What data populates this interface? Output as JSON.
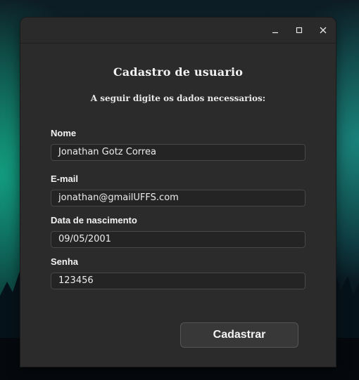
{
  "window": {
    "controls": {
      "minimize_icon": "minimize-icon",
      "maximize_icon": "maximize-icon",
      "close_icon": "close-icon"
    }
  },
  "form": {
    "title": "Cadastro de usuario",
    "subtitle": "A seguir digite os dados necessarios:",
    "fields": [
      {
        "label": "Nome",
        "value": "Jonathan Gotz Correa"
      },
      {
        "label": "E-mail",
        "value": "jonathan@gmailUFFS.com"
      },
      {
        "label": "Data de nascimento",
        "value": "09/05/2001"
      },
      {
        "label": "Senha",
        "value": "123456"
      }
    ],
    "submit_label": "Cadastrar"
  },
  "colors": {
    "window_bg": "#2b2b2b",
    "field_bg": "#242424",
    "text": "#f2f2f2"
  }
}
